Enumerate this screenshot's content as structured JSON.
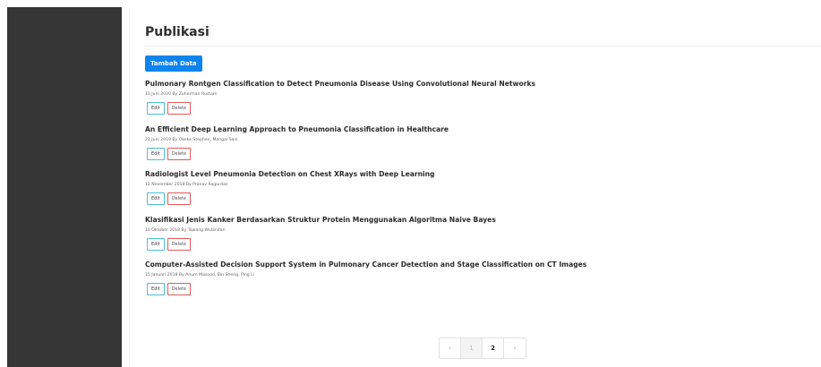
{
  "page": {
    "title": "Publikasi",
    "add_button_label": "Tambah Data"
  },
  "publications": [
    {
      "title": "Pulmonary Rontgen Classification to Detect Pneumonia Disease Using Convolutional Neural Networks",
      "meta": "11 Juni 2020 By Zuherman Rustam",
      "edit_label": "Edit",
      "delete_label": "Delete"
    },
    {
      "title": "An Efficient Deep Learning Approach to Pneumonia Classification in Healthcare",
      "meta": "22 Juni 2019 By Okeke Stephen, Mangal Sain",
      "edit_label": "Edit",
      "delete_label": "Delete"
    },
    {
      "title": "Radiologist Level Pneumonia Detection on Chest XRays with Deep Learning",
      "meta": "12 November 2018 By Pranav Rajpurkar",
      "edit_label": "Edit",
      "delete_label": "Delete"
    },
    {
      "title": "Klasifikasi Jenis Kanker Berdasarkan Struktur Protein Menggunakan Algoritma Naive Bayes",
      "meta": "10 Oktober 2018 By Tawang Wulandari",
      "edit_label": "Edit",
      "delete_label": "Delete"
    },
    {
      "title": "Computer-Assisted Decision Support System in Pulmonary Cancer Detection and Stage Classification on CT Images",
      "meta": "15 Januari 2018 By Anum Masood, Bin Sheng, Ping Li",
      "edit_label": "Edit",
      "delete_label": "Delete"
    }
  ],
  "pagination": {
    "prev": "‹",
    "pages": [
      "1",
      "2"
    ],
    "next": "›"
  }
}
